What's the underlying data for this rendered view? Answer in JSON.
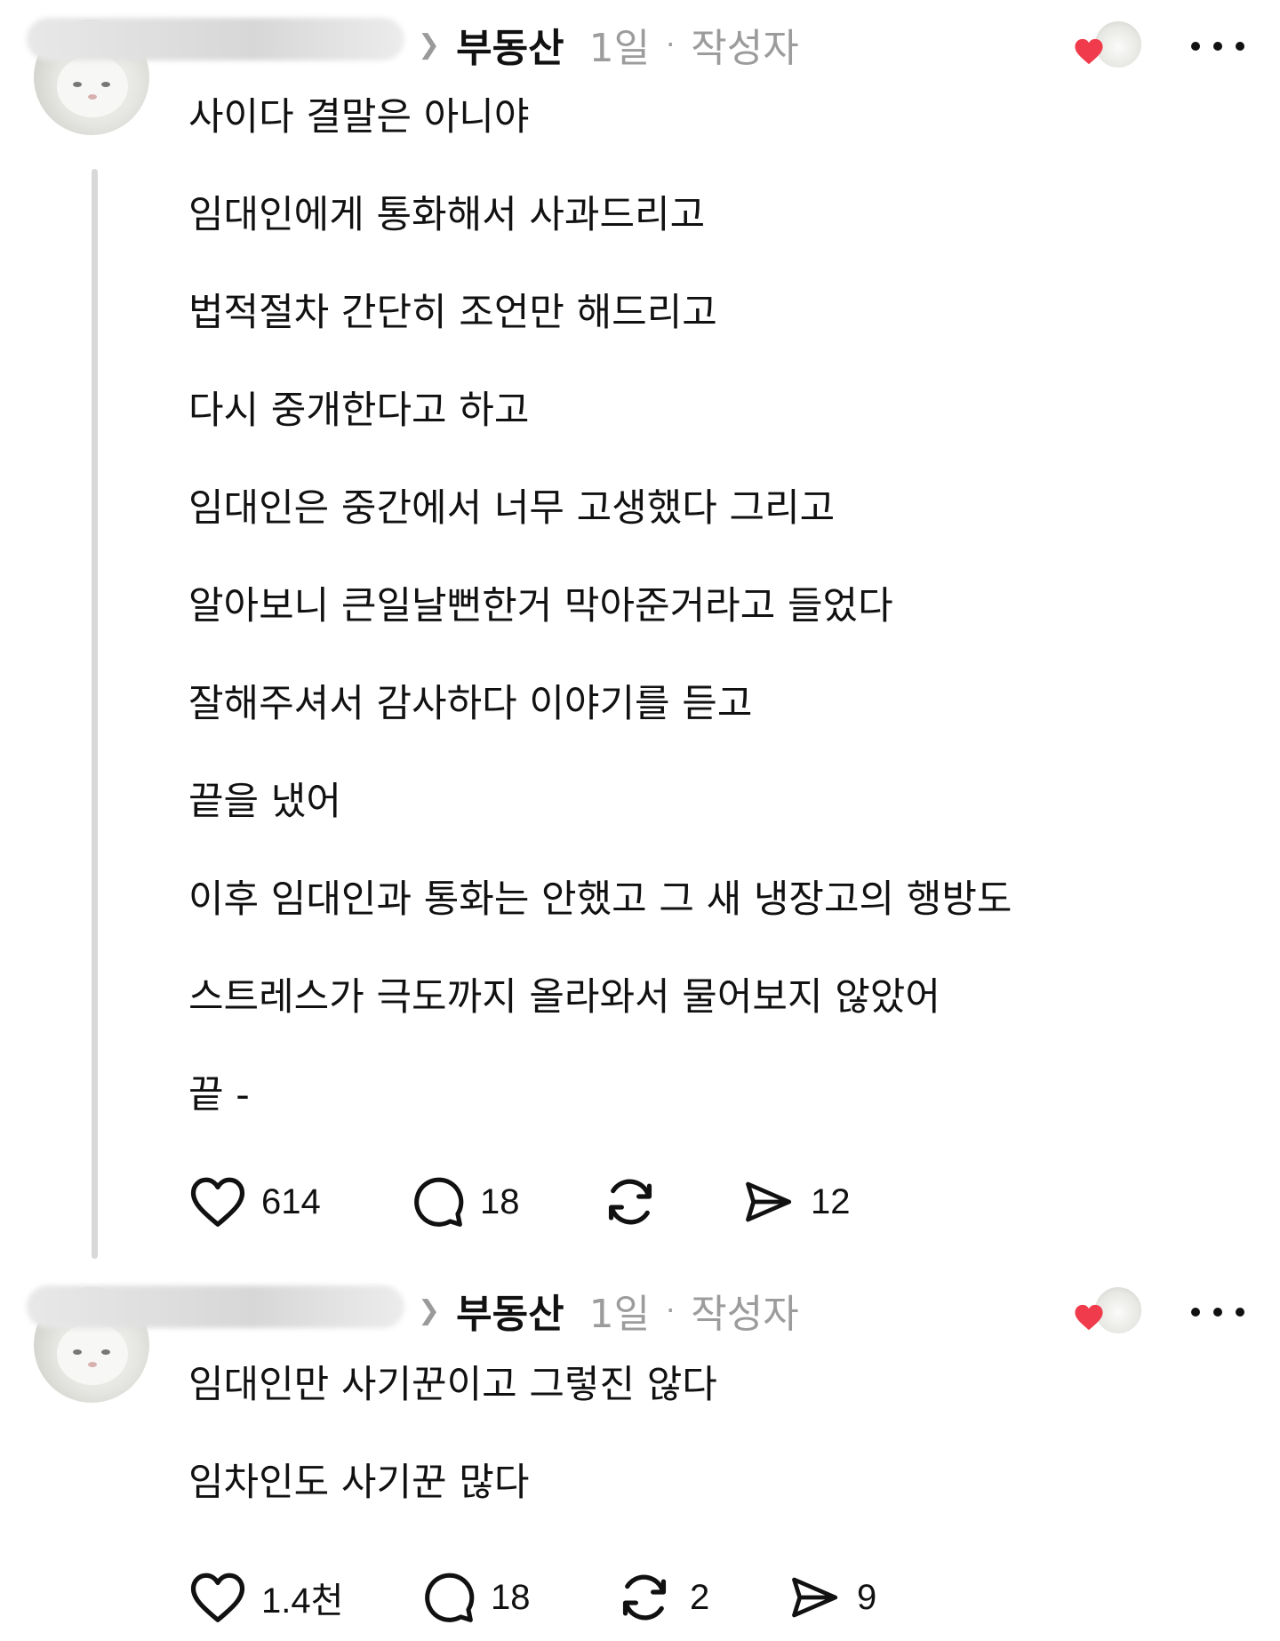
{
  "posts": [
    {
      "topic": "부동산",
      "time": "1일",
      "separator": "·",
      "author_tag": "작성자",
      "lines": [
        "사이다 결말은 아니야",
        "임대인에게 통화해서 사과드리고",
        "법적절차 간단히 조언만 해드리고",
        "다시 중개한다고 하고",
        "임대인은 중간에서 너무 고생했다 그리고",
        "알아보니 큰일날뻔한거 막아준거라고 들었다",
        "잘해주셔서 감사하다 이야기를 듣고",
        "끝을 냈어",
        "이후 임대인과 통화는 안했고 그 새 냉장고의 행방도",
        "스트레스가 극도까지 올라와서 물어보지 않았어",
        "끝 -"
      ],
      "actions": {
        "like_count": "614",
        "reply_count": "18",
        "repost_count": "",
        "share_count": "12"
      }
    },
    {
      "topic": "부동산",
      "time": "1일",
      "separator": "·",
      "author_tag": "작성자",
      "lines": [
        "임대인만 사기꾼이고 그렇진 않다",
        "임차인도 사기꾼 많다"
      ],
      "actions": {
        "like_count": "1.4천",
        "reply_count": "18",
        "repost_count": "2",
        "share_count": "9"
      }
    }
  ],
  "icons": {
    "chevron": "chevron-right-icon",
    "like": "heart-icon",
    "reply": "speech-bubble-icon",
    "repost": "repost-arrows-icon",
    "share": "send-icon",
    "more": "more-dots-icon"
  },
  "colors": {
    "text": "#111111",
    "muted": "#9c9c9c",
    "heart": "#ef3b4b",
    "thread_line": "#d8d8d8"
  }
}
